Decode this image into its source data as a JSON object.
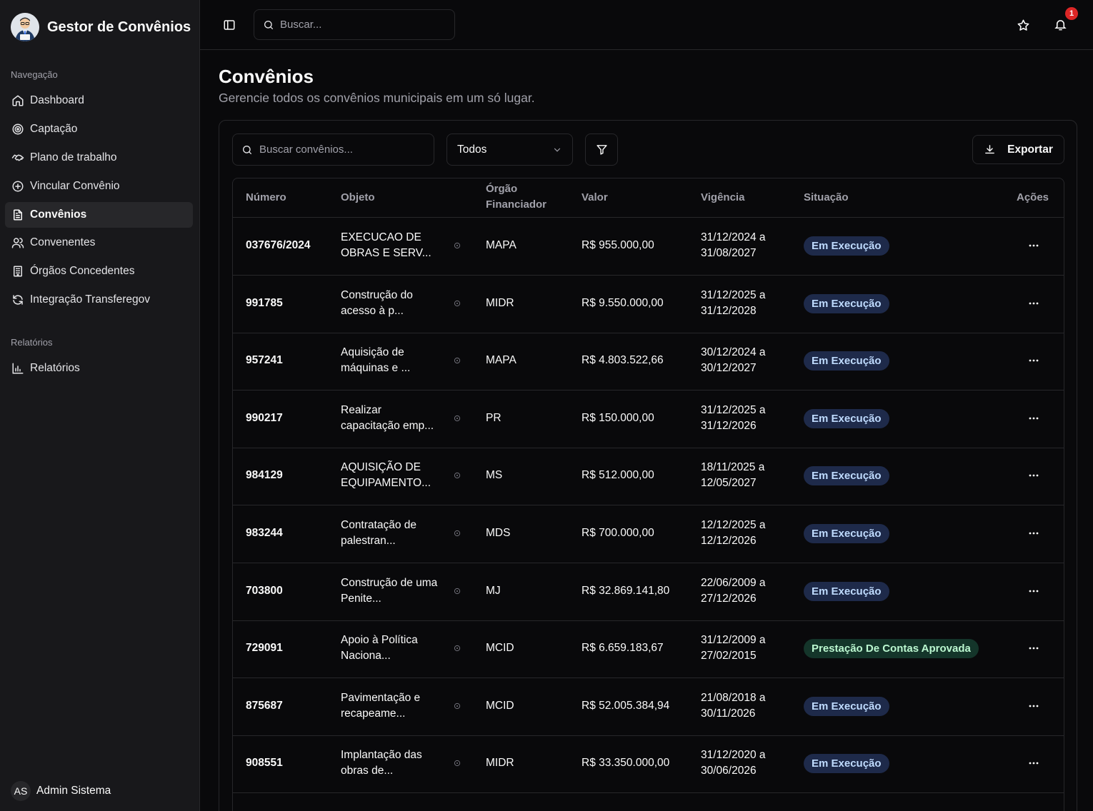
{
  "app": {
    "title": "Gestor de Convênios"
  },
  "sidebar": {
    "section_nav": "Navegação",
    "items": [
      {
        "label": "Dashboard",
        "icon": "home-icon",
        "active": false
      },
      {
        "label": "Captação",
        "icon": "target-icon",
        "active": false
      },
      {
        "label": "Plano de trabalho",
        "icon": "handshake-icon",
        "active": false
      },
      {
        "label": "Vincular Convênio",
        "icon": "plus-circle-icon",
        "active": false
      },
      {
        "label": "Convênios",
        "icon": "file-text-icon",
        "active": true
      },
      {
        "label": "Convenentes",
        "icon": "users-icon",
        "active": false
      },
      {
        "label": "Órgãos Concedentes",
        "icon": "building-icon",
        "active": false
      },
      {
        "label": "Integração Transferegov",
        "icon": "refresh-icon",
        "active": false
      }
    ],
    "section_reports": "Relatórios",
    "report_items": [
      {
        "label": "Relatórios",
        "icon": "bar-chart-icon"
      }
    ],
    "user": {
      "initials": "AS",
      "name": "Admin Sistema"
    }
  },
  "topbar": {
    "search_placeholder": "Buscar...",
    "notification_count": "1"
  },
  "page": {
    "title": "Convênios",
    "subtitle": "Gerencie todos os convênios municipais em um só lugar."
  },
  "toolbar": {
    "search_placeholder": "Buscar convênios...",
    "filter_value": "Todos",
    "export_label": "Exportar"
  },
  "table": {
    "headers": {
      "numero": "Número",
      "objeto": "Objeto",
      "orgao_1": "Órgão",
      "orgao_2": "Financiador",
      "valor": "Valor",
      "vigencia": "Vigência",
      "situacao": "Situação",
      "acoes": "Ações"
    },
    "rows": [
      {
        "numero": "037676/2024",
        "objeto_1": "EXECUCAO DE",
        "objeto_2": "OBRAS E SERV...",
        "orgao": "MAPA",
        "valor": "R$ 955.000,00",
        "vig_1": "31/12/2024 a",
        "vig_2": "31/08/2027",
        "situacao": "Em Execução",
        "status": "exec"
      },
      {
        "numero": "991785",
        "objeto_1": "Construção do",
        "objeto_2": "acesso à p...",
        "orgao": "MIDR",
        "valor": "R$ 9.550.000,00",
        "vig_1": "31/12/2025 a",
        "vig_2": "31/12/2028",
        "situacao": "Em Execução",
        "status": "exec"
      },
      {
        "numero": "957241",
        "objeto_1": "Aquisição de",
        "objeto_2": "máquinas e ...",
        "orgao": "MAPA",
        "valor": "R$ 4.803.522,66",
        "vig_1": "30/12/2024 a",
        "vig_2": "30/12/2027",
        "situacao": "Em Execução",
        "status": "exec"
      },
      {
        "numero": "990217",
        "objeto_1": "Realizar",
        "objeto_2": "capacitação emp...",
        "orgao": "PR",
        "valor": "R$ 150.000,00",
        "vig_1": "31/12/2025 a",
        "vig_2": "31/12/2026",
        "situacao": "Em Execução",
        "status": "exec"
      },
      {
        "numero": "984129",
        "objeto_1": "AQUISIÇÃO DE",
        "objeto_2": "EQUIPAMENTO...",
        "orgao": "MS",
        "valor": "R$ 512.000,00",
        "vig_1": "18/11/2025 a",
        "vig_2": "12/05/2027",
        "situacao": "Em Execução",
        "status": "exec"
      },
      {
        "numero": "983244",
        "objeto_1": "Contratação de",
        "objeto_2": "palestran...",
        "orgao": "MDS",
        "valor": "R$ 700.000,00",
        "vig_1": "12/12/2025 a",
        "vig_2": "12/12/2026",
        "situacao": "Em Execução",
        "status": "exec"
      },
      {
        "numero": "703800",
        "objeto_1": "Construção de uma",
        "objeto_2": "Penite...",
        "orgao": "MJ",
        "valor": "R$ 32.869.141,80",
        "vig_1": "22/06/2009 a",
        "vig_2": "27/12/2026",
        "situacao": "Em Execução",
        "status": "exec"
      },
      {
        "numero": "729091",
        "objeto_1": "Apoio à Política",
        "objeto_2": "Naciona...",
        "orgao": "MCID",
        "valor": "R$ 6.659.183,67",
        "vig_1": "31/12/2009 a",
        "vig_2": "27/02/2015",
        "situacao": "Prestação De Contas Aprovada",
        "status": "ok"
      },
      {
        "numero": "875687",
        "objeto_1": "Pavimentação e",
        "objeto_2": "recapeame...",
        "orgao": "MCID",
        "valor": "R$ 52.005.384,94",
        "vig_1": "21/08/2018 a",
        "vig_2": "30/11/2026",
        "situacao": "Em Execução",
        "status": "exec"
      },
      {
        "numero": "908551",
        "objeto_1": "Implantação das",
        "objeto_2": "obras de...",
        "orgao": "MIDR",
        "valor": "R$ 33.350.000,00",
        "vig_1": "31/12/2020 a",
        "vig_2": "30/06/2026",
        "situacao": "Em Execução",
        "status": "exec"
      }
    ]
  }
}
